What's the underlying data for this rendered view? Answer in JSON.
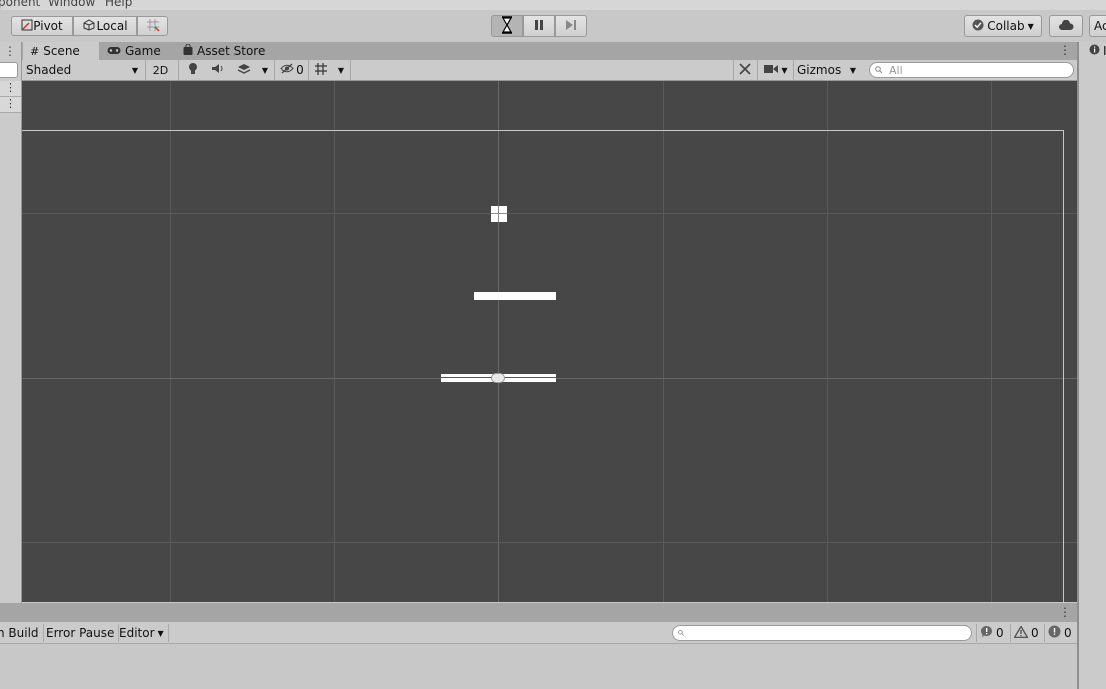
{
  "menubar": {
    "items": [
      "ponent",
      "Window",
      "Help"
    ]
  },
  "toolbar": {
    "pivot_label": "Pivot",
    "local_label": "Local",
    "collab_label": "Collab",
    "account_label": "Ac"
  },
  "tabs": [
    {
      "label": "Scene"
    },
    {
      "label": "Game"
    },
    {
      "label": "Asset Store"
    }
  ],
  "scene_toolbar": {
    "shading_mode": "Shaded",
    "mode_2d": "2D",
    "hidden_count": "0",
    "gizmos_label": "Gizmos",
    "search_placeholder": "All"
  },
  "console": {
    "build_label": "n Build",
    "error_pause_label": "Error Pause",
    "editor_label": "Editor",
    "log_count": "0",
    "warning_count": "0",
    "error_count": "0"
  },
  "colors": {
    "scene_bg": "#474747",
    "grid_line": "#5a5a5a",
    "toolbar_bg": "#c8c8c8",
    "panel_bg": "#cbcbcb"
  }
}
